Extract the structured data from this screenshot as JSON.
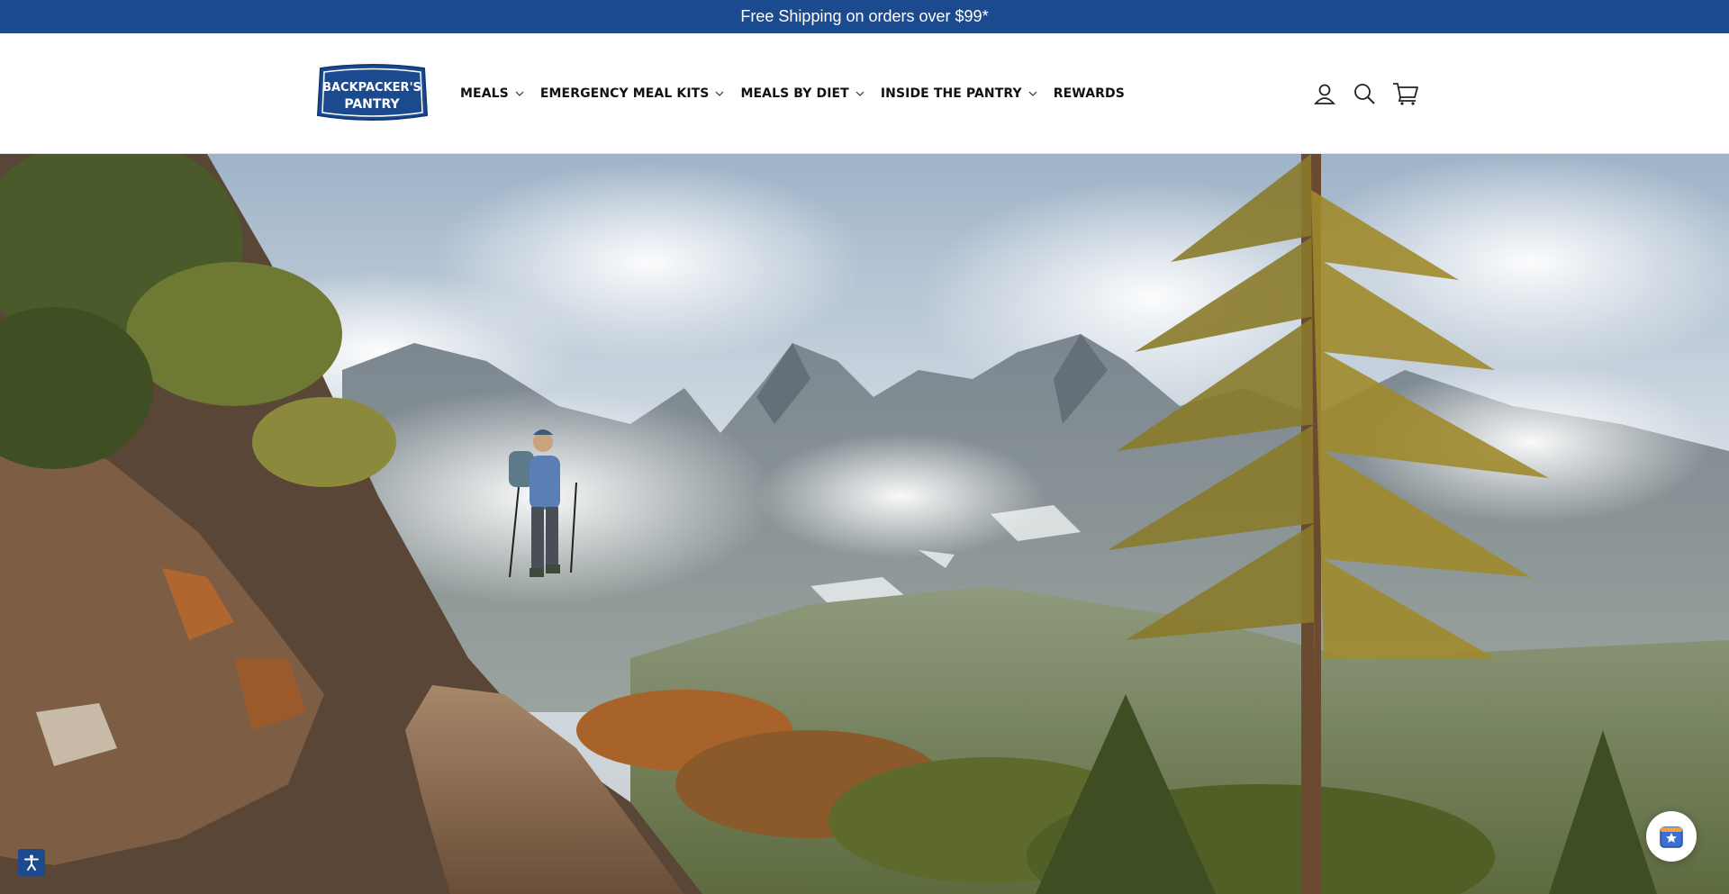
{
  "announcement": {
    "text": "Free Shipping on orders over $99*"
  },
  "brand": {
    "line1": "BACKPACKER'S",
    "line2": "PANTRY",
    "color": "#1c4a8f"
  },
  "nav": {
    "items": [
      {
        "label": "MEALS",
        "has_dropdown": true
      },
      {
        "label": "EMERGENCY MEAL KITS",
        "has_dropdown": true
      },
      {
        "label": "MEALS BY DIET",
        "has_dropdown": true
      },
      {
        "label": "INSIDE THE PANTRY",
        "has_dropdown": true
      },
      {
        "label": "REWARDS",
        "has_dropdown": false
      }
    ]
  },
  "header_icons": [
    "account-icon",
    "search-icon",
    "cart-icon"
  ],
  "floating": {
    "accessibility": "accessibility-icon",
    "chat": "rewards-star-icon"
  },
  "colors": {
    "announcement_bg": "#1c4a8f",
    "text": "#111111"
  }
}
